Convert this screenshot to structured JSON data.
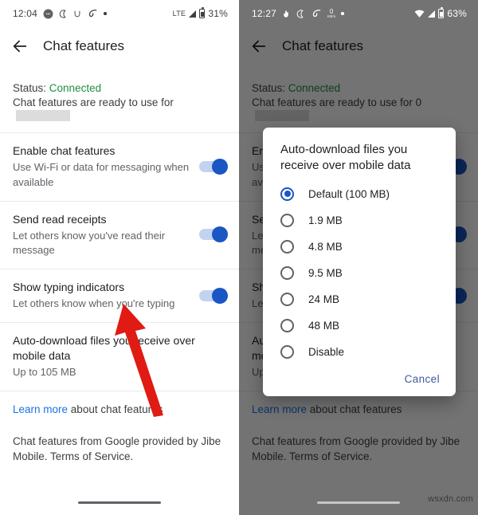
{
  "left_panel": {
    "status_bar": {
      "clock": "12:04",
      "network_label": "LTE",
      "battery_percent": "31%",
      "icons": [
        "chat-bubble-icon",
        "crescent-moon-icon",
        "u-letter-icon",
        "data-saver-icon",
        "dot-icon"
      ]
    },
    "app_bar": {
      "back_icon": "back-arrow-icon",
      "title": "Chat features"
    },
    "status_section": {
      "label": "Status:",
      "value": "Connected",
      "description": "Chat features are ready to use for",
      "redacted": true
    },
    "rows": [
      {
        "title": "Enable chat features",
        "subtitle": "Use Wi-Fi or data for messaging when available",
        "toggle": "on"
      },
      {
        "title": "Send read receipts",
        "subtitle": "Let others know you've read their message",
        "toggle": "on"
      },
      {
        "title": "Show typing indicators",
        "subtitle": "Let others know when you're typing",
        "toggle": "on"
      },
      {
        "title": "Auto-download files you receive over mobile data",
        "subtitle": "Up to 105 MB",
        "toggle": "none"
      }
    ],
    "learn_more": {
      "link_text": "Learn more",
      "rest_text": " about chat features"
    },
    "footer_text": "Chat features from Google provided by Jibe Mobile. Terms of Service.",
    "annotation": {
      "type": "red-arrow",
      "color": "#e01b13"
    }
  },
  "right_panel": {
    "status_bar": {
      "clock": "12:27",
      "battery_percent": "63%",
      "icons": [
        "hand-icon",
        "crescent-moon-icon",
        "data-saver-icon",
        "data-rate-icon",
        "dot-icon",
        "wifi-icon",
        "signal-icon",
        "battery-icon"
      ],
      "data_rate": "0",
      "data_rate_unit": "KB/s"
    },
    "app_bar": {
      "back_icon": "back-arrow-icon",
      "title": "Chat features"
    },
    "status_section": {
      "label": "Status:",
      "value": "Connected",
      "description": "Chat features are ready to use for 0",
      "redacted": true
    },
    "rows": [
      {
        "title": "Enable chat features",
        "subtitle": "Use Wi-Fi or data for messaging when available",
        "toggle": "on"
      },
      {
        "title": "Send read receipts",
        "subtitle": "Let others know you've read their message",
        "toggle": "on"
      },
      {
        "title": "Show typing indicators",
        "subtitle": "Let others know when you're typing",
        "toggle": "on"
      },
      {
        "title": "Auto-download files you receive over mobile data",
        "subtitle": "Up to 105 MB",
        "toggle": "none"
      }
    ],
    "learn_more": {
      "link_text": "Learn more",
      "rest_text": " about chat features"
    },
    "footer_text": "Chat features from Google provided by Jibe Mobile. Terms of Service.",
    "dialog": {
      "title": "Auto-download files you receive over mobile data",
      "options": [
        {
          "label": "Default (100 MB)",
          "selected": true
        },
        {
          "label": "1.9 MB",
          "selected": false
        },
        {
          "label": "4.8 MB",
          "selected": false
        },
        {
          "label": "9.5 MB",
          "selected": false
        },
        {
          "label": "24 MB",
          "selected": false
        },
        {
          "label": "48 MB",
          "selected": false
        },
        {
          "label": "Disable",
          "selected": false
        }
      ],
      "cancel_label": "Cancel"
    }
  },
  "watermark": "wsxdn.com",
  "colors": {
    "accent_blue": "#1a56c4",
    "link_blue": "#1a73e8",
    "connected_green": "#1e8e3e",
    "scrim": "rgba(0,0,0,0.55)",
    "arrow_red": "#e01b13"
  }
}
